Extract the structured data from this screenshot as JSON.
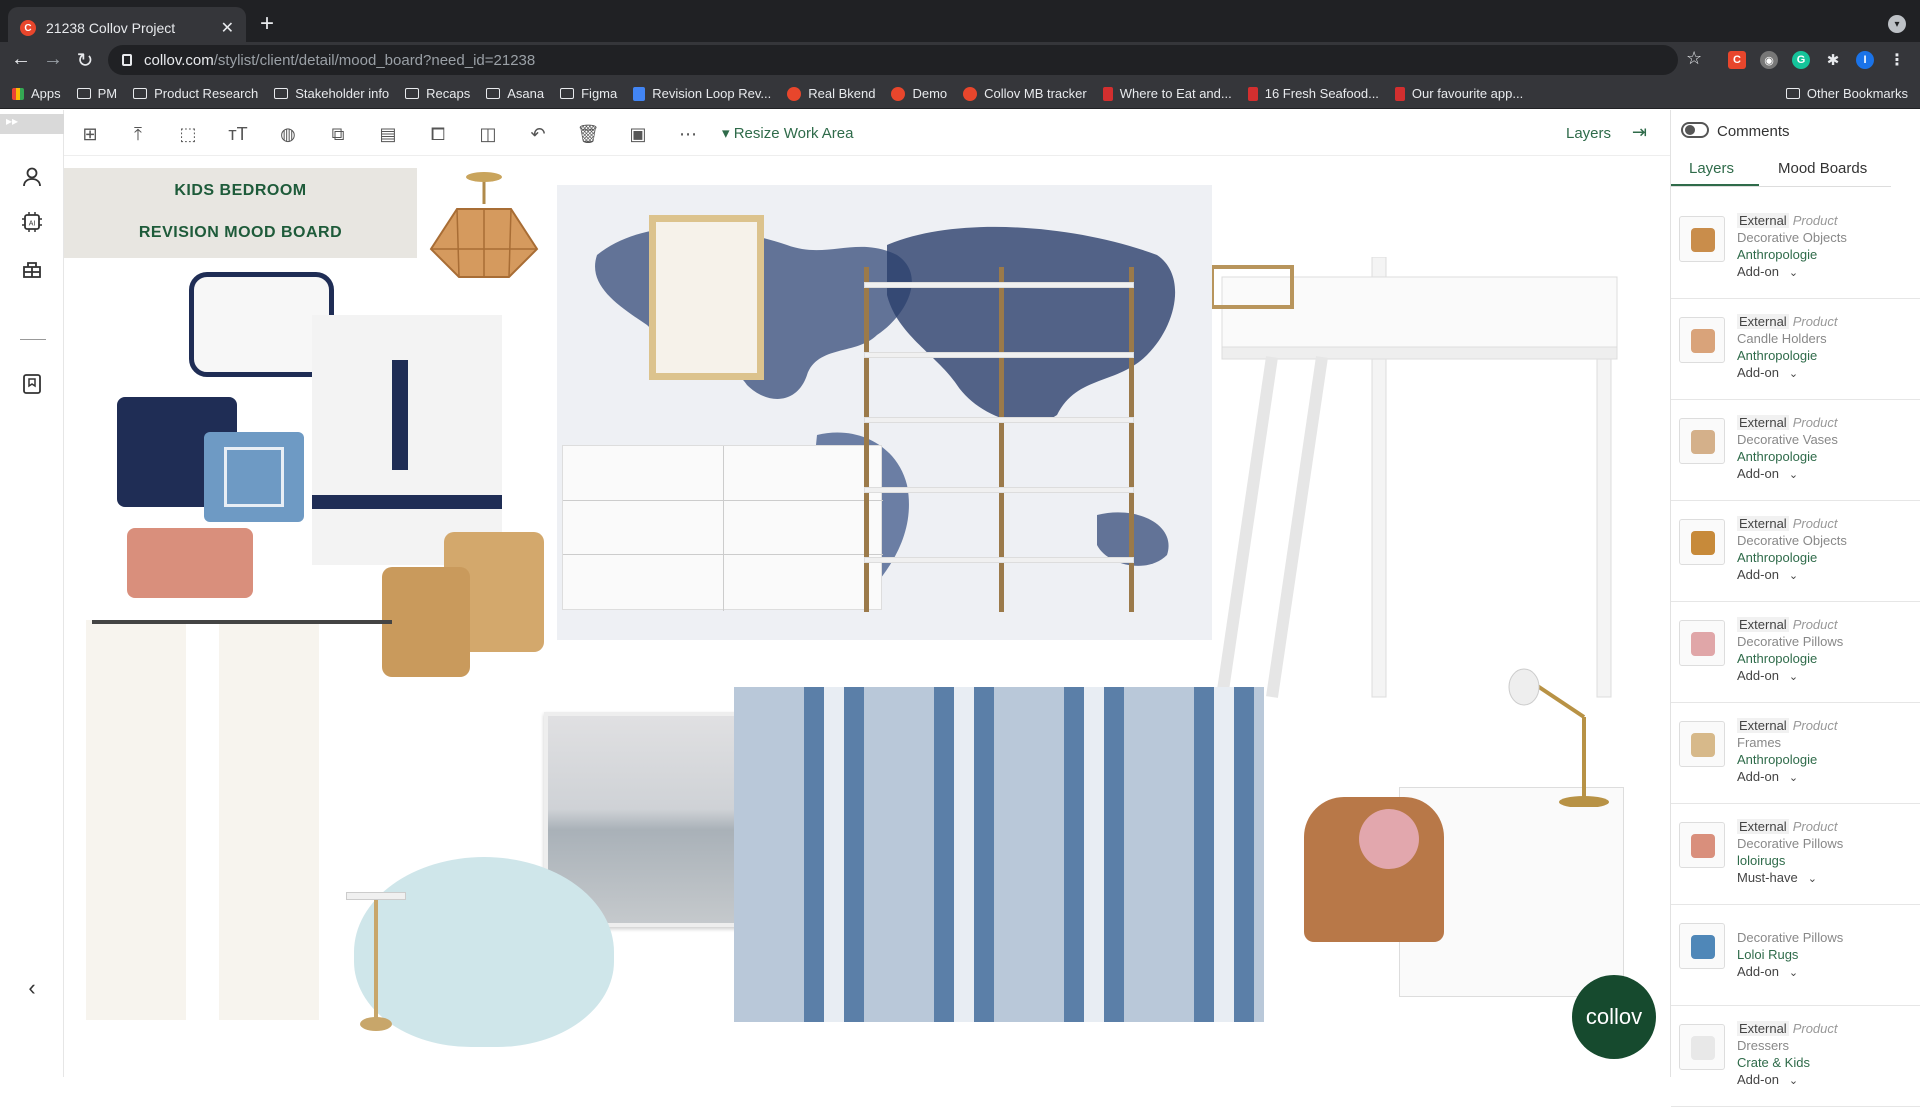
{
  "browser": {
    "tab_title": "21238 Collov Project",
    "tab_favicon": "C",
    "url_domain": "collov.com",
    "url_path": "/stylist/client/detail/mood_board?need_id=21238",
    "profile_initial": "I"
  },
  "bookmarks": [
    {
      "label": "Apps",
      "icon": "grid"
    },
    {
      "label": "PM",
      "icon": "folder"
    },
    {
      "label": "Product Research",
      "icon": "folder"
    },
    {
      "label": "Stakeholder info",
      "icon": "folder"
    },
    {
      "label": "Recaps",
      "icon": "folder"
    },
    {
      "label": "Asana",
      "icon": "folder"
    },
    {
      "label": "Figma",
      "icon": "folder"
    },
    {
      "label": "Revision Loop Rev...",
      "icon": "doc"
    },
    {
      "label": "Real Bkend",
      "icon": "c"
    },
    {
      "label": "Demo",
      "icon": "c"
    },
    {
      "label": "Collov MB tracker",
      "icon": "c"
    },
    {
      "label": "Where to Eat and...",
      "icon": "e"
    },
    {
      "label": "16 Fresh Seafood...",
      "icon": "e"
    },
    {
      "label": "Our favourite app...",
      "icon": "e"
    }
  ],
  "other_bookmarks": "Other Bookmarks",
  "toolbar": {
    "resize_label": "Resize Work Area",
    "layers_label": "Layers"
  },
  "moodboard": {
    "title_line1": "KIDS BEDROOM",
    "title_line2": "REVISION MOOD BOARD"
  },
  "right_panel": {
    "comments_label": "Comments",
    "tabs": [
      {
        "label": "Layers",
        "active": true
      },
      {
        "label": "Mood Boards",
        "active": false
      }
    ],
    "layers": [
      {
        "tag": "External",
        "type": "Product",
        "category": "Decorative Objects",
        "vendor": "Anthropologie",
        "priority": "Add-on",
        "color": "#c98d4b"
      },
      {
        "tag": "External",
        "type": "Product",
        "category": "Candle Holders",
        "vendor": "Anthropologie",
        "priority": "Add-on",
        "color": "#d9a37a"
      },
      {
        "tag": "External",
        "type": "Product",
        "category": "Decorative Vases",
        "vendor": "Anthropologie",
        "priority": "Add-on",
        "color": "#d4b08a"
      },
      {
        "tag": "External",
        "type": "Product",
        "category": "Decorative Objects",
        "vendor": "Anthropologie",
        "priority": "Add-on",
        "color": "#c78a3a"
      },
      {
        "tag": "External",
        "type": "Product",
        "category": "Decorative Pillows",
        "vendor": "Anthropologie",
        "priority": "Add-on",
        "color": "#e0a6a8"
      },
      {
        "tag": "External",
        "type": "Product",
        "category": "Frames",
        "vendor": "Anthropologie",
        "priority": "Add-on",
        "color": "#d7b98a"
      },
      {
        "tag": "External",
        "type": "Product",
        "category": "Decorative Pillows",
        "vendor": "loloirugs",
        "priority": "Must-have",
        "color": "#d98f7c"
      },
      {
        "tag": "",
        "type": "",
        "category": "Decorative Pillows",
        "vendor": "Loloi Rugs",
        "priority": "Add-on",
        "color": "#4f87b8"
      },
      {
        "tag": "External",
        "type": "Product",
        "category": "Dressers",
        "vendor": "Crate & Kids",
        "priority": "Add-on",
        "color": "#e8e8e8"
      }
    ]
  },
  "brand_logo": "collov",
  "colors": {
    "brand_green": "#1e5b3a",
    "navy": "#1f2d55",
    "denim": "#5b7fa8"
  }
}
